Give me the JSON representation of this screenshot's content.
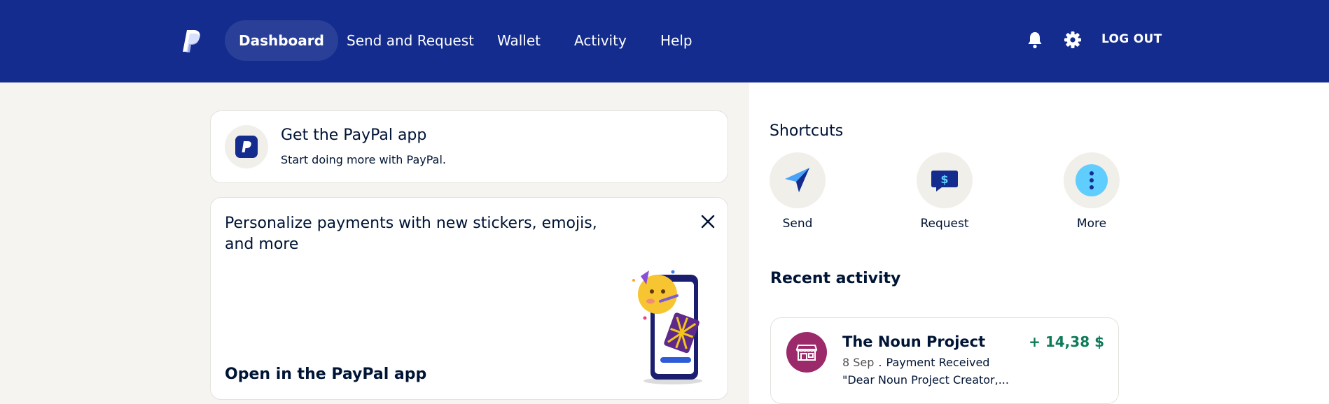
{
  "header": {
    "nav": [
      {
        "label": "Dashboard",
        "active": true
      },
      {
        "label": "Send and Request",
        "active": false
      },
      {
        "label": "Wallet",
        "active": false
      },
      {
        "label": "Activity",
        "active": false
      },
      {
        "label": "Help",
        "active": false
      }
    ],
    "logout_label": "LOG OUT",
    "icons": [
      "paypal-logo",
      "bell-icon",
      "gear-icon"
    ]
  },
  "app_promo": {
    "title": "Get the PayPal app",
    "subtitle": "Start doing more with PayPal."
  },
  "stickers_promo": {
    "text": "Personalize payments with new stickers, emojis, and more",
    "cta": "Open in the PayPal app"
  },
  "shortcuts": {
    "title": "Shortcuts",
    "items": [
      {
        "label": "Send",
        "icon": "paper-plane-icon"
      },
      {
        "label": "Request",
        "icon": "dollar-chat-icon"
      },
      {
        "label": "More",
        "icon": "more-vertical-icon"
      }
    ]
  },
  "recent_activity": {
    "title": "Recent activity",
    "items": [
      {
        "name": "The Noun Project",
        "amount": "+ 14,38 $",
        "date": "8 Sep",
        "separator": ".",
        "type": "Payment Received",
        "note": "\"Dear Noun Project Creator,..."
      }
    ]
  },
  "colors": {
    "header_bg": "#142c8e",
    "page_bg": "#f5f4f0",
    "amount_positive": "#0e7a5a",
    "avatar_bg": "#9c2a6b",
    "more_icon_bg": "#60cdff"
  }
}
